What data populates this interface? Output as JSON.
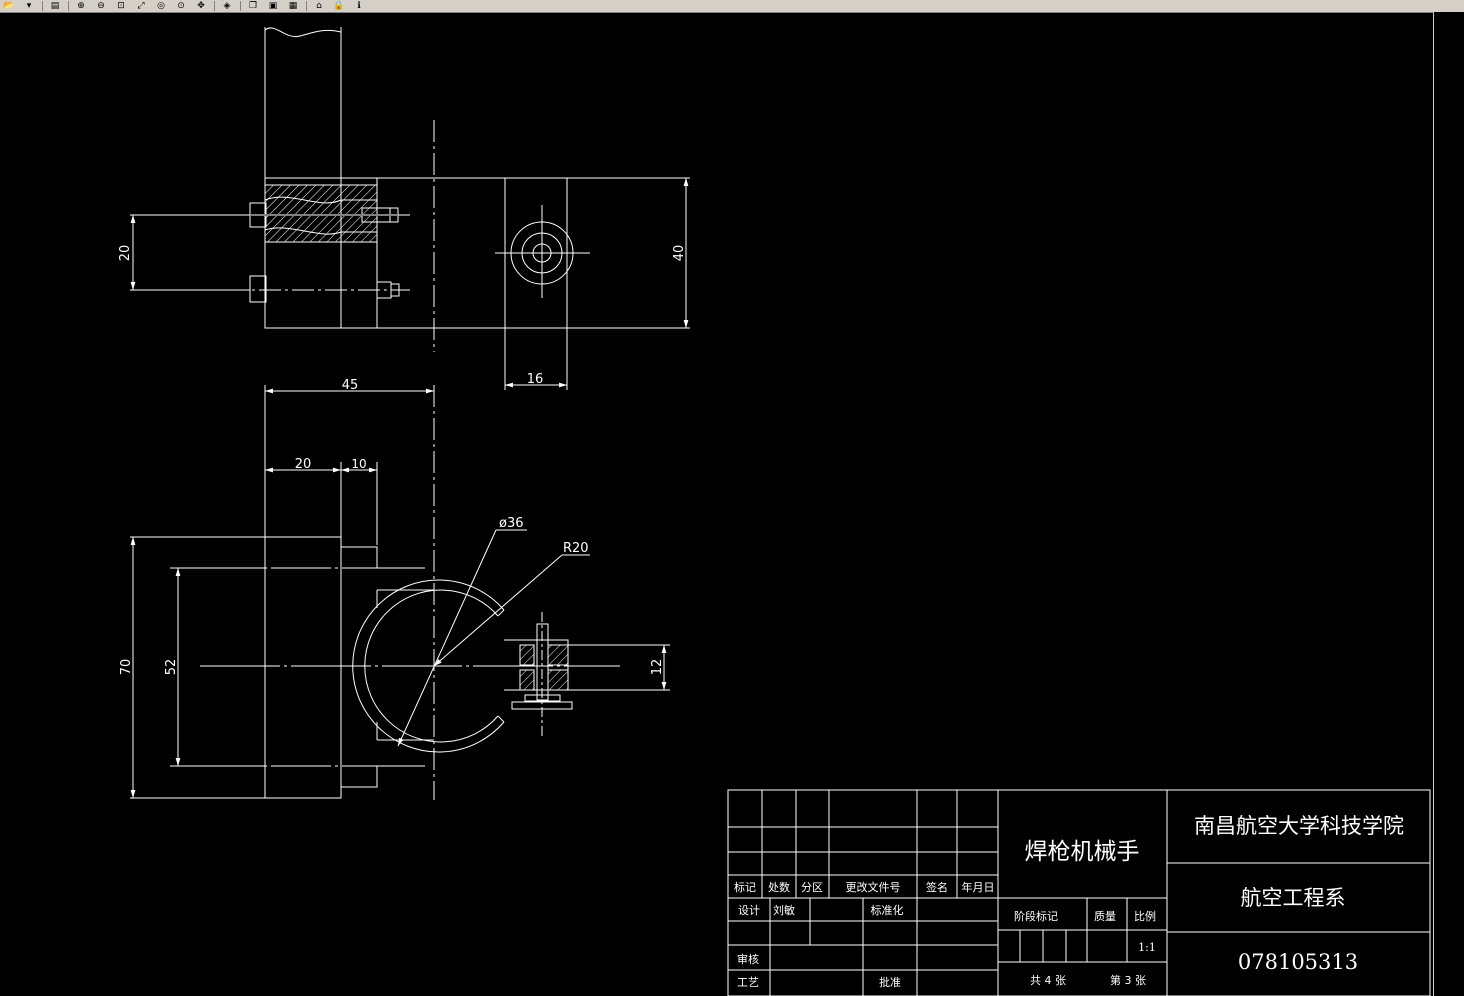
{
  "toolbar": {
    "buttons": [
      {
        "icon": "open-file-icon",
        "glyph": "📂"
      },
      {
        "icon": "dropdown-arrow-icon",
        "glyph": "▾"
      },
      {
        "icon": "print-icon",
        "glyph": "▤"
      },
      {
        "icon": "zoom-in-icon",
        "glyph": "⊕"
      },
      {
        "icon": "zoom-out-icon",
        "glyph": "⊖"
      },
      {
        "icon": "zoom-window-icon",
        "glyph": "⊡"
      },
      {
        "icon": "zoom-extents-icon",
        "glyph": "⤢"
      },
      {
        "icon": "zoom-previous-icon",
        "glyph": "◎"
      },
      {
        "icon": "realtime-zoom-icon",
        "glyph": "⊙"
      },
      {
        "icon": "pan-icon",
        "glyph": "✥"
      },
      {
        "icon": "layers-icon",
        "glyph": "◈"
      },
      {
        "icon": "copy-icon",
        "glyph": "❐"
      },
      {
        "icon": "paste-icon",
        "glyph": "▣"
      },
      {
        "icon": "save-icon",
        "glyph": "▦"
      },
      {
        "icon": "home-icon",
        "glyph": "⌂"
      },
      {
        "icon": "lock-icon",
        "glyph": "🔒"
      },
      {
        "icon": "info-icon",
        "glyph": "ℹ"
      }
    ]
  },
  "dimensions": {
    "d20_top": "20",
    "d40": "40",
    "d16": "16",
    "d45": "45",
    "d20_mid": "20",
    "d10": "10",
    "d36": "ø36",
    "r20": "R20",
    "d70": "70",
    "d52": "52",
    "d12": "12"
  },
  "title_block": {
    "headers": [
      "标记",
      "处数",
      "分区",
      "更改文件号",
      "签名",
      "年月日"
    ],
    "design_label": "设计",
    "designer": "刘敏",
    "standardization_label": "标准化",
    "review_label": "审核",
    "process_label": "工艺",
    "approve_label": "批准",
    "stage_label": "阶段标记",
    "quality_label": "质量",
    "scale_label": "比例",
    "scale_value": "1:1",
    "total_sheets": "共 4 张",
    "sheet_no": "第 3 张",
    "drawing_name": "焊枪机械手",
    "school": "南昌航空大学科技学院",
    "department": "航空工程系",
    "drawing_number": "078105313"
  },
  "colors": {
    "background": "#000000",
    "lines": "#ffffff",
    "toolbar": "#d4d0c8"
  }
}
